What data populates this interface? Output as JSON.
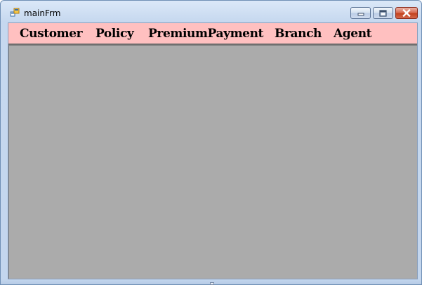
{
  "window": {
    "title": "mainFrm",
    "icon": "winforms-app-icon"
  },
  "title_controls": {
    "minimize_icon": "minimize-icon",
    "maximize_icon": "maximize-icon",
    "close_icon": "close-icon"
  },
  "menu": {
    "items": [
      {
        "label": "Customer"
      },
      {
        "label": "Policy"
      },
      {
        "label": "PremiumPayment"
      },
      {
        "label": "Branch"
      },
      {
        "label": "Agent"
      }
    ]
  },
  "colors": {
    "menubar_background": "#ffc0c0",
    "mdi_client_background": "#ababab",
    "close_button": "#c3421f"
  }
}
